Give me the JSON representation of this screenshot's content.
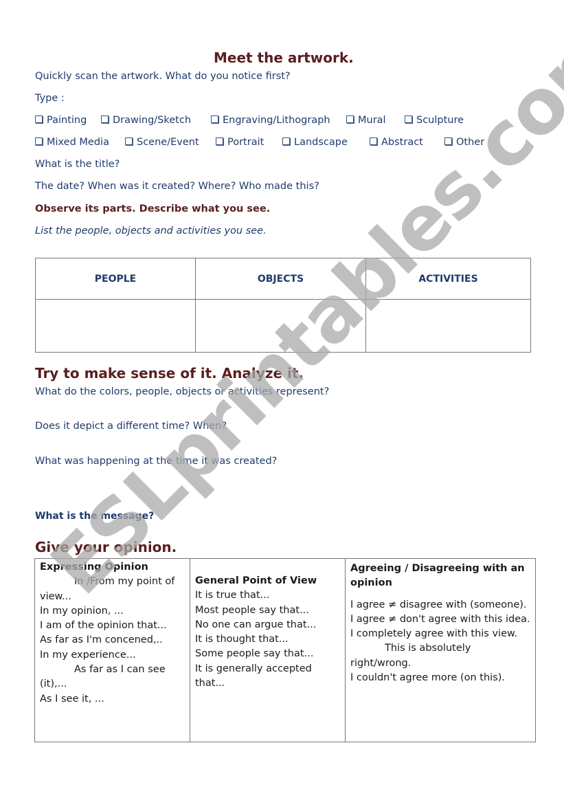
{
  "title": "Meet the artwork.",
  "intro_question": "Quickly scan the artwork. What do you notice first?",
  "type_label": "Type :",
  "type_options_row1": [
    "Painting",
    "Drawing/Sketch",
    "Engraving/Lithograph",
    "Mural",
    "Sculpture"
  ],
  "type_options_row2": [
    "Mixed Media",
    "Scene/Event",
    "Portrait",
    "Landscape",
    "Abstract",
    "Other"
  ],
  "q_title": "What is the title?",
  "q_date": "The date? When was it created? Where? Who made this?",
  "observe_heading": "Observe its parts. Describe what you see.",
  "observe_instruction": "List the people, objects and activities you see.",
  "observation_table": {
    "headers": [
      "PEOPLE",
      "OBJECTS",
      "ACTIVITIES"
    ],
    "rows": [
      [
        "",
        "",
        ""
      ]
    ]
  },
  "analyze_heading": "Try to make sense of it. Analyze it.",
  "analyze_questions": [
    "What do the colors, people, objects or activities represent?",
    "Does it depict a different time? When?",
    "What was happening at the time it was created?"
  ],
  "message_question": "What is the message?",
  "opinion_heading": "Give your opinion.",
  "opinion_table": {
    "columns": [
      {
        "heading": "Expressing Opinion",
        "lines": [
          "In /From my point of",
          "view...",
          "In my opinion, ...",
          "I am of the opinion that...",
          "As far as I'm concened,..",
          "In my experience...",
          "As far as I can see",
          "(it),...",
          "As I see it, ..."
        ]
      },
      {
        "heading": "General Point of View",
        "lines": [
          "It is true that...",
          "Most people say that...",
          "No one can argue that...",
          "It is thought that...",
          "Some people say that...",
          "It is generally accepted",
          "that..."
        ]
      },
      {
        "heading": "Agreeing / Disagreeing with an opinion",
        "lines": [
          "I agree ≠ disagree with (someone).",
          "I agree ≠ don't agree with this idea.",
          "I completely agree with this view.",
          "This is absolutely",
          "right/wrong.",
          "I couldn't agree more (on this)."
        ]
      }
    ]
  },
  "watermark": "ESLprintables.com",
  "colors": {
    "heading": "#5a1e1e",
    "text": "#1f3b6b",
    "watermark": "#aaaaaa"
  }
}
